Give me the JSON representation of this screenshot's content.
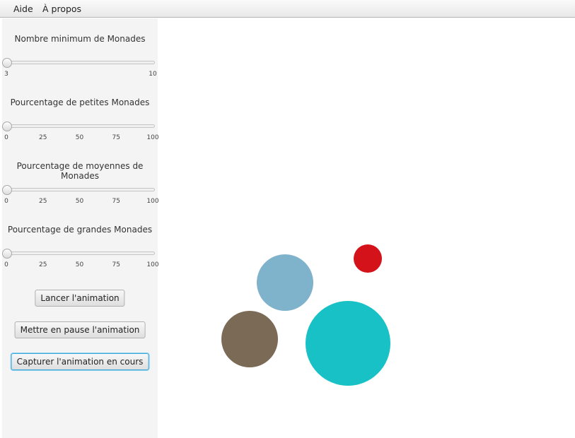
{
  "menu": {
    "help": "Aide",
    "about": "À propos"
  },
  "sliders": [
    {
      "title": "Nombre minimum de Monades",
      "min": 3,
      "max": 10,
      "value": 3,
      "ticks": [
        "3",
        "10"
      ]
    },
    {
      "title": "Pourcentage de petites Monades",
      "min": 0,
      "max": 100,
      "value": 0,
      "ticks": [
        "0",
        "25",
        "50",
        "75",
        "100"
      ]
    },
    {
      "title": "Pourcentage de moyennes de Monades",
      "min": 0,
      "max": 100,
      "value": 0,
      "ticks": [
        "0",
        "25",
        "50",
        "75",
        "100"
      ]
    },
    {
      "title": "Pourcentage de grandes Monades",
      "min": 0,
      "max": 100,
      "value": 0,
      "ticks": [
        "0",
        "25",
        "50",
        "75",
        "100"
      ]
    }
  ],
  "buttons": {
    "start": "Lancer l'animation",
    "pause": "Mettre en pause l'animation",
    "capture": "Capturer l'animation en cours"
  },
  "monads": [
    {
      "color": "#7fb2cb"
    },
    {
      "color": "#d3121a"
    },
    {
      "color": "#7b6a55"
    },
    {
      "color": "#17c1c6"
    }
  ]
}
